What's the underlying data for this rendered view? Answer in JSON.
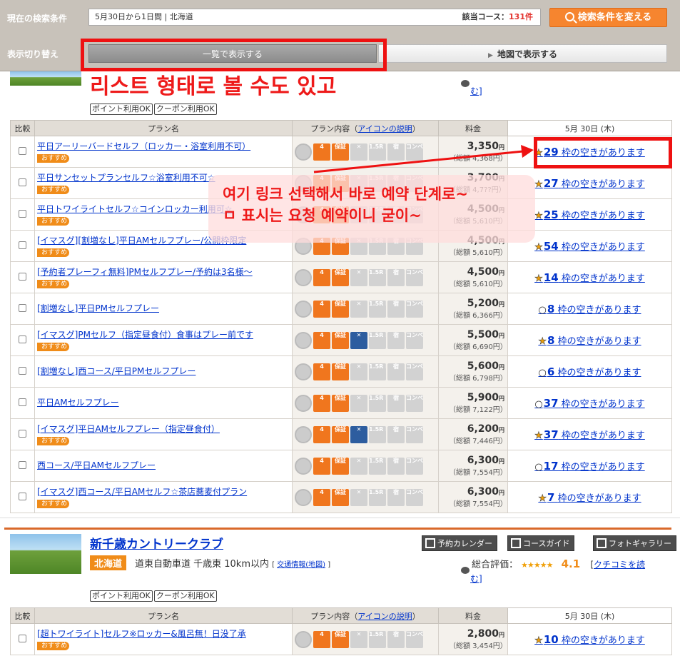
{
  "topbar": {
    "condition_label": "現在の検索条件",
    "condition_text": "5月30日から1日間 | 北海道",
    "count_label": "該当コース：",
    "count_value": "131件",
    "search_button": "検索条件を変える",
    "display_label": "表示切り替え",
    "list_button": "一覧で表示する",
    "map_button": "地図で表示する"
  },
  "annotations": {
    "top_note": "리스트 형태로 볼 수도 있고",
    "callout_line1": "여기 링크 선택해서 바로 예약 단계로~",
    "callout_line2": "ㅁ 표시는 요청 예약이니 굳이~"
  },
  "course1": {
    "review_tail": "む]",
    "tag_points": "ポイント利用OK",
    "tag_coupon": "クーポン利用OK"
  },
  "table_headers": {
    "compare": "比較",
    "plan_name": "プラン名",
    "plan_content": "プラン内容",
    "icon_help": "アイコンの説明",
    "price": "料金",
    "date": "5月 30日 (木)"
  },
  "icons": {
    "cart": "4",
    "guarantee": "保証",
    "lsr": "1.5R PLAY",
    "stay": "宿",
    "combo": "コンペ 特典"
  },
  "plans": [
    {
      "name": "平日アーリーバードセルフ（ロッカー・浴室利用不可）",
      "recommended": "おすすめ",
      "price": "3,350",
      "yen": "円",
      "total": "（総額 4,368円）",
      "symbol": "★",
      "slots": "29",
      "avail": "枠の空きがあります",
      "meal": false
    },
    {
      "name": "平日サンセットプランセルフ☆浴室利用不可☆",
      "recommended": "おすすめ",
      "price": "3,700",
      "yen": "円",
      "total": "（総額 4,7??円）",
      "symbol": "★",
      "slots": "27",
      "avail": "枠の空きがあります",
      "meal": false
    },
    {
      "name": "平日トワイライトセルフ☆コインロッカー利用可☆",
      "recommended": "おすすめ",
      "price": "4,500",
      "yen": "円",
      "total": "（総額 5,610円）",
      "symbol": "★",
      "slots": "25",
      "avail": "枠の空きがあります",
      "meal": false
    },
    {
      "name": "[イマスグ][割増なし]平日AMセルフプレー/公開枠限定",
      "recommended": "おすすめ",
      "price": "4,500",
      "yen": "円",
      "total": "（総額 5,610円）",
      "symbol": "★",
      "slots": "54",
      "avail": "枠の空きがあります",
      "meal": false
    },
    {
      "name": "[予約者プレーフィ無料]PMセルフプレー/予約は3名様〜",
      "recommended": "おすすめ",
      "price": "4,500",
      "yen": "円",
      "total": "（総額 5,610円）",
      "symbol": "★",
      "slots": "14",
      "avail": "枠の空きがあります",
      "meal": false
    },
    {
      "name": "[割増なし]平日PMセルフプレー",
      "recommended": "",
      "price": "5,200",
      "yen": "円",
      "total": "（総額 6,366円）",
      "symbol": "○",
      "slots": "8",
      "avail": "枠の空きがあります",
      "meal": false
    },
    {
      "name": "[イマスグ]PMセルフ（指定昼食付）食事はプレー前です",
      "recommended": "おすすめ",
      "price": "5,500",
      "yen": "円",
      "total": "（総額 6,690円）",
      "symbol": "★",
      "slots": "8",
      "avail": "枠の空きがあります",
      "meal": true
    },
    {
      "name": "[割増なし]西コース/平日PMセルフプレー",
      "recommended": "",
      "price": "5,600",
      "yen": "円",
      "total": "（総額 6,798円）",
      "symbol": "○",
      "slots": "6",
      "avail": "枠の空きがあります",
      "meal": false
    },
    {
      "name": "平日AMセルフプレー",
      "recommended": "",
      "price": "5,900",
      "yen": "円",
      "total": "（総額 7,122円）",
      "symbol": "○",
      "slots": "37",
      "avail": "枠の空きがあります",
      "meal": false
    },
    {
      "name": "[イマスグ]平日AMセルフプレー（指定昼食付）",
      "recommended": "おすすめ",
      "price": "6,200",
      "yen": "円",
      "total": "（総額 7,446円）",
      "symbol": "★",
      "slots": "37",
      "avail": "枠の空きがあります",
      "meal": true
    },
    {
      "name": "西コース/平日AMセルフプレー",
      "recommended": "",
      "price": "6,300",
      "yen": "円",
      "total": "（総額 7,554円）",
      "symbol": "○",
      "slots": "17",
      "avail": "枠の空きがあります",
      "meal": false
    },
    {
      "name": "[イマスグ]西コース/平日AMセルフ☆茶店蕎麦付プラン",
      "recommended": "おすすめ",
      "price": "6,300",
      "yen": "円",
      "total": "（総額 7,554円）",
      "symbol": "★",
      "slots": "7",
      "avail": "枠の空きがあります",
      "meal": false
    }
  ],
  "course2": {
    "name": "新千歳カントリークラブ",
    "region": "北海道",
    "access": "道東自動車道 千歳東 10km以内",
    "access_link": "交通情報(地図)",
    "btn_calendar": "予約カレンダー",
    "btn_guide": "コースガイド",
    "btn_gallery": "フォトギャラリー",
    "rating_label": "総合評価：",
    "stars": "★★★★★",
    "score": "4.1",
    "review_link": "クチコミを読",
    "review_tail": "む]",
    "tag_points": "ポイント利用OK",
    "tag_coupon": "クーポン利用OK",
    "plan": {
      "name": "[超トワイライト]セルフ※ロッカー&風呂無！日没了承",
      "recommended": "おすすめ",
      "price": "2,800",
      "yen": "円",
      "total": "（総額 3,454円）",
      "symbol": "★",
      "slots": "10",
      "avail": "枠の空きがあります"
    }
  },
  "colors": {
    "accent": "#f08c19",
    "annotation": "#ee1a1a",
    "link": "#0033cc"
  }
}
